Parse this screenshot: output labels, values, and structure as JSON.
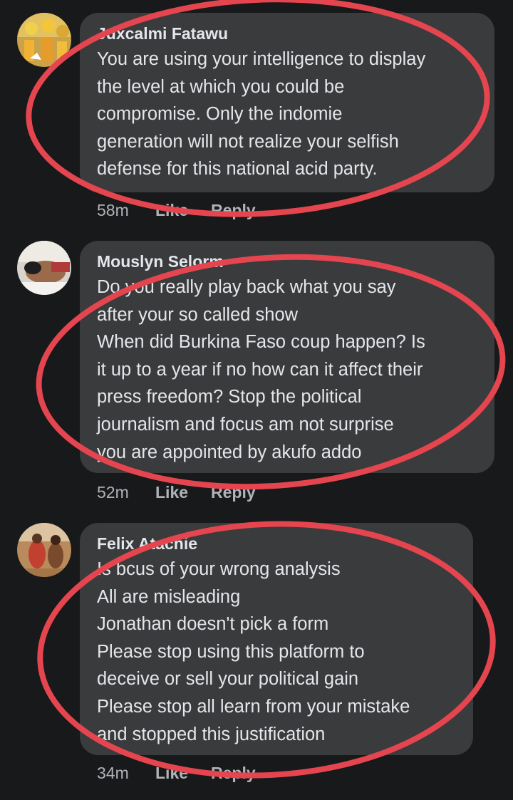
{
  "comments": [
    {
      "author": "Juxcalmi Fatawu",
      "lines": [
        "You are using your intelligence to display",
        "the level at which you could be",
        "compromise. Only the indomie",
        "generation will not realize your selfish",
        "defense for this national acid party."
      ],
      "time": "58m",
      "like": "Like",
      "reply": "Reply"
    },
    {
      "author": "Mouslyn Selorm",
      "lines": [
        "Do you really play back what you say",
        "after your so called show",
        "When did Burkina Faso coup happen? Is",
        "it up to a year if no how can it affect their",
        "press freedom? Stop the political",
        "journalism and focus am not surprise",
        "you are appointed by akufo addo"
      ],
      "time": "52m",
      "like": "Like",
      "reply": "Reply"
    },
    {
      "author": "Felix Atachie",
      "lines": [
        "Is bcus of your wrong analysis",
        "All are misleading",
        "Jonathan doesn't pick a form",
        "Please stop using this platform to",
        "deceive or sell your political gain",
        "Please stop all learn from your mistake",
        "and stopped this justification"
      ],
      "time": "34m",
      "like": "Like",
      "reply": "Reply"
    }
  ],
  "colors": {
    "background": "#18191a",
    "bubble": "#3a3b3c",
    "text": "#e4e6eb",
    "meta": "#b0b3b8",
    "annotation": "#e5454f"
  }
}
